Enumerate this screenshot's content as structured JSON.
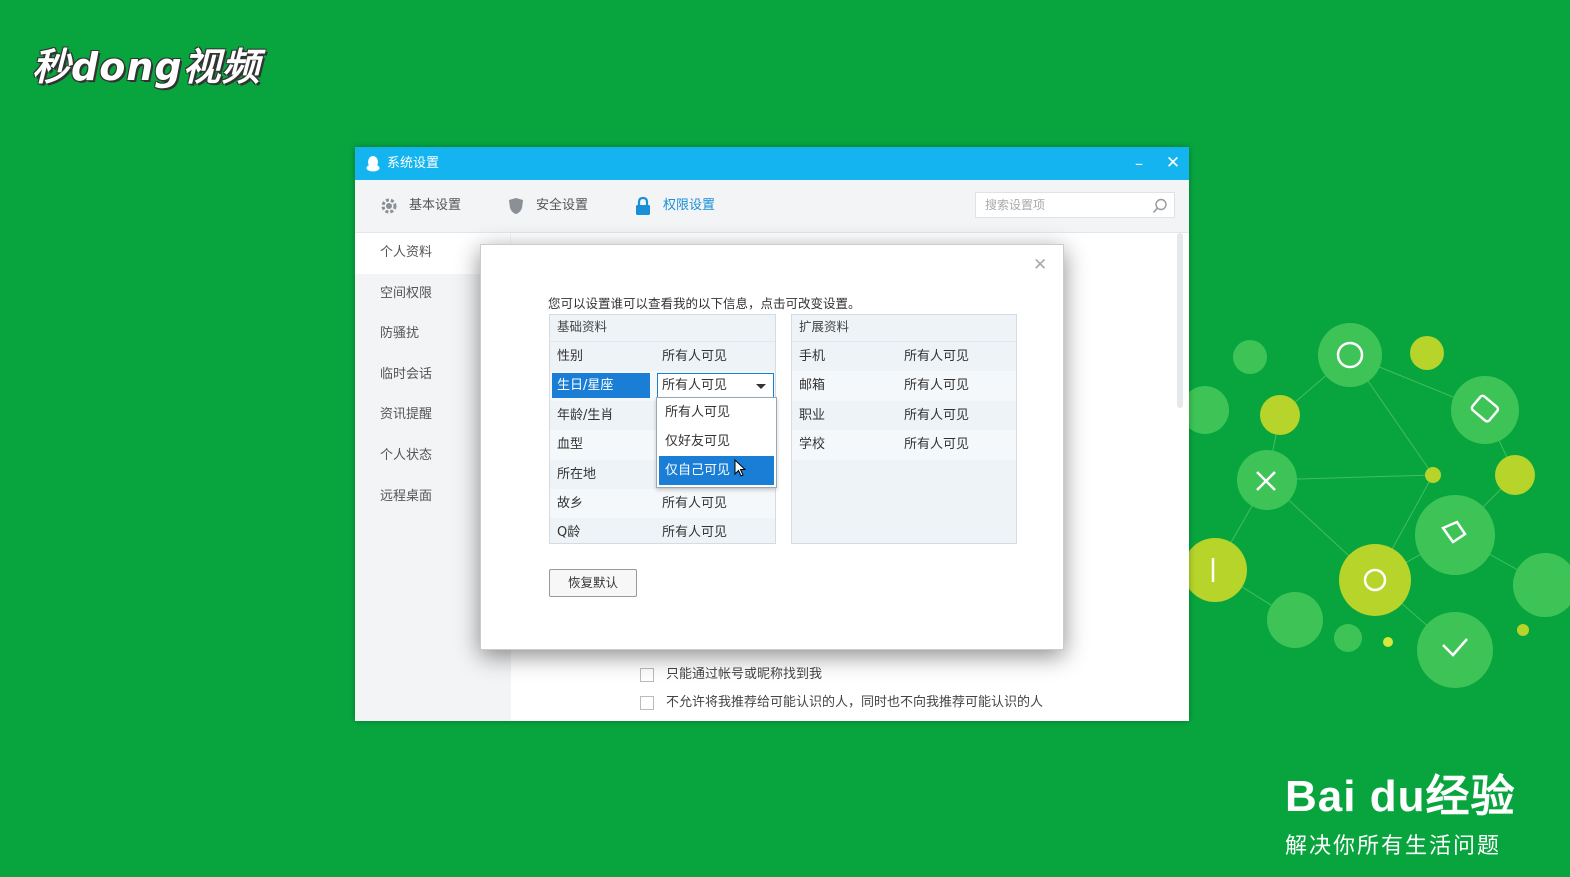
{
  "watermark": {
    "top_left_logo": "秒dong视频",
    "brand": "Bai du经验",
    "slogan": "解决你所有生活问题"
  },
  "window": {
    "title": "系统设置",
    "controls": {
      "minimize": "–",
      "close": "✕"
    },
    "tabs": [
      {
        "label": "基本设置",
        "icon": "gear-icon",
        "active": false
      },
      {
        "label": "安全设置",
        "icon": "shield-icon",
        "active": false
      },
      {
        "label": "权限设置",
        "icon": "lock-icon",
        "active": true
      }
    ],
    "search": {
      "placeholder": "搜索设置项"
    },
    "sidebar": {
      "items": [
        "个人资料",
        "空间权限",
        "防骚扰",
        "临时会话",
        "资讯提醒",
        "个人状态",
        "远程桌面"
      ],
      "active_index": 0
    },
    "content": {
      "options": [
        {
          "label": "只能通过帐号或昵称找到我",
          "checked": false
        },
        {
          "label": "不允许将我推荐给可能认识的人，同时也不向我推荐可能认识的人",
          "checked": false
        }
      ]
    }
  },
  "dialog": {
    "close": "✕",
    "intro": "您可以设置谁可以查看我的以下信息，点击可改变设置。",
    "basic": {
      "header": "基础资料",
      "rows": [
        {
          "key": "性别",
          "value": "所有人可见"
        },
        {
          "key": "生日/星座",
          "value": "所有人可见",
          "selected": true
        },
        {
          "key": "年龄/生肖",
          "value": ""
        },
        {
          "key": "血型",
          "value": ""
        },
        {
          "key": "所在地",
          "value": ""
        },
        {
          "key": "故乡",
          "value": "所有人可见"
        },
        {
          "key": "Q龄",
          "value": "所有人可见"
        }
      ]
    },
    "extended": {
      "header": "扩展资料",
      "rows": [
        {
          "key": "手机",
          "value": "所有人可见"
        },
        {
          "key": "邮箱",
          "value": "所有人可见"
        },
        {
          "key": "职业",
          "value": "所有人可见"
        },
        {
          "key": "学校",
          "value": "所有人可见"
        }
      ]
    },
    "dropdown": {
      "current": "所有人可见",
      "options": [
        "所有人可见",
        "仅好友可见",
        "仅自己可见"
      ],
      "highlighted_index": 2
    },
    "reset_label": "恢复默认"
  },
  "colors": {
    "background": "#08a53f",
    "titlebar": "#13b4f0",
    "accent": "#1a7ed6"
  }
}
